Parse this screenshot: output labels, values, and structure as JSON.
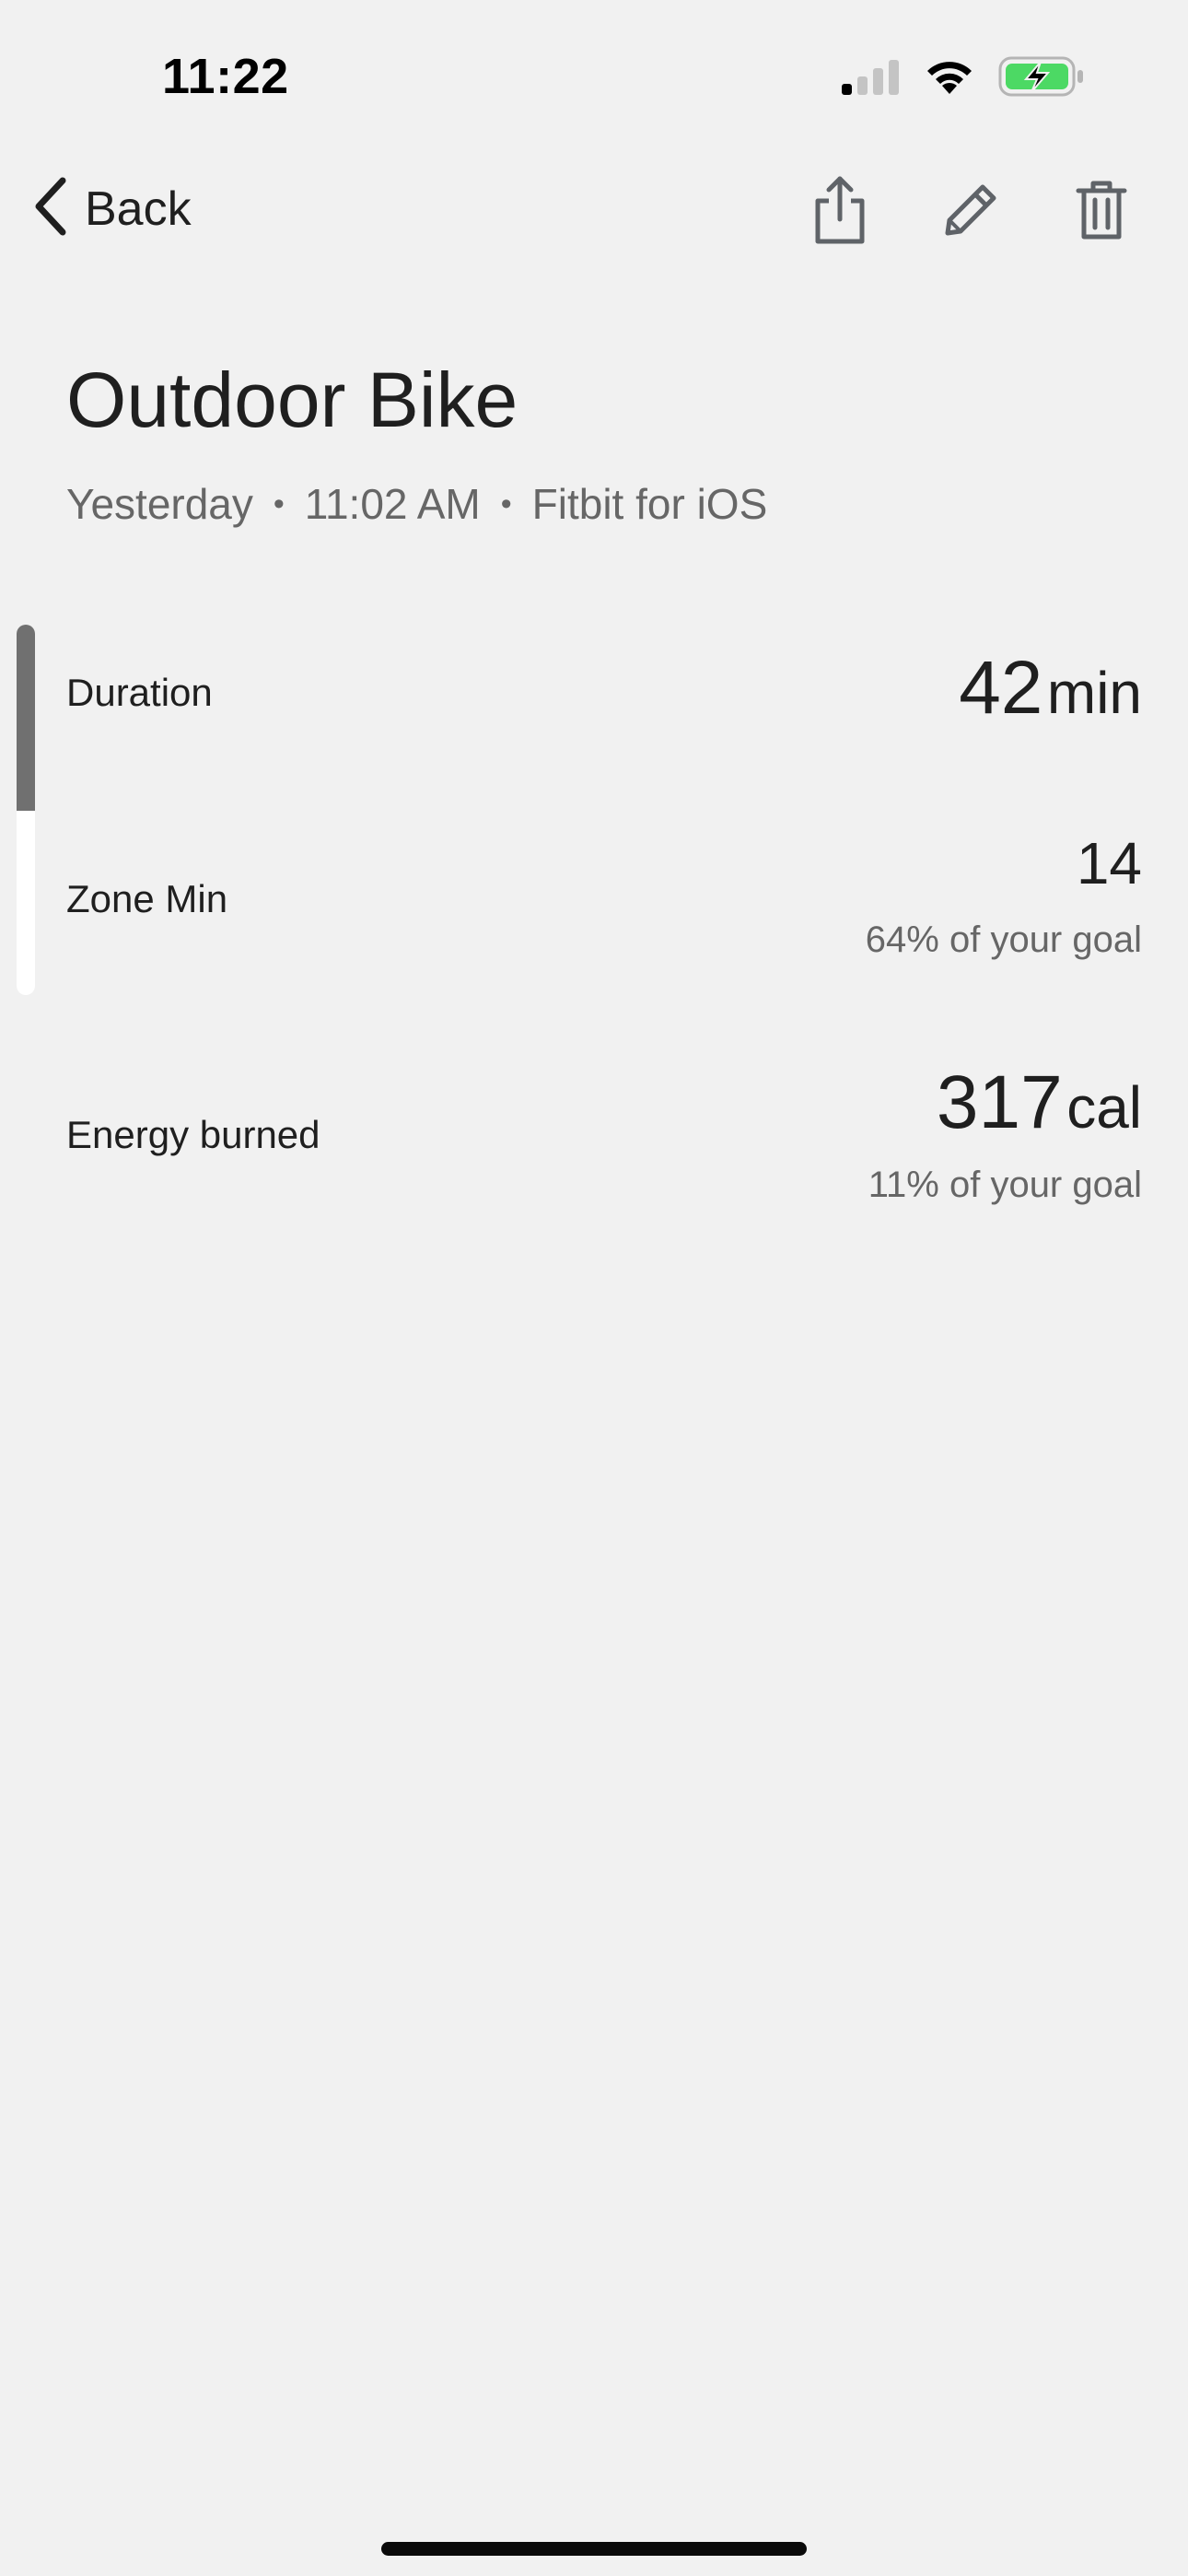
{
  "status_bar": {
    "time": "11:22",
    "icons": [
      "cellular-signal-icon",
      "wifi-icon",
      "battery-charging-icon"
    ],
    "battery_color": "#4cd964"
  },
  "nav": {
    "back_label": "Back",
    "actions": [
      "share-icon",
      "pencil-icon",
      "trash-icon"
    ]
  },
  "header": {
    "title": "Outdoor Bike",
    "day": "Yesterday",
    "time": "11:02 AM",
    "source": "Fitbit for iOS",
    "separator": "•"
  },
  "scroll": {
    "position_fraction": 0.5
  },
  "stats": {
    "duration": {
      "label": "Duration",
      "value": "42",
      "unit": "min"
    },
    "zone": {
      "label": "Zone Min",
      "value": "14",
      "goal": "64% of your goal"
    },
    "energy": {
      "label": "Energy burned",
      "value": "317",
      "unit": "cal",
      "goal": "11% of your goal"
    }
  },
  "colors": {
    "background": "#f1f1f1",
    "text_primary": "#1f1f1f",
    "text_secondary": "#666666",
    "icon": "#5f6368"
  }
}
